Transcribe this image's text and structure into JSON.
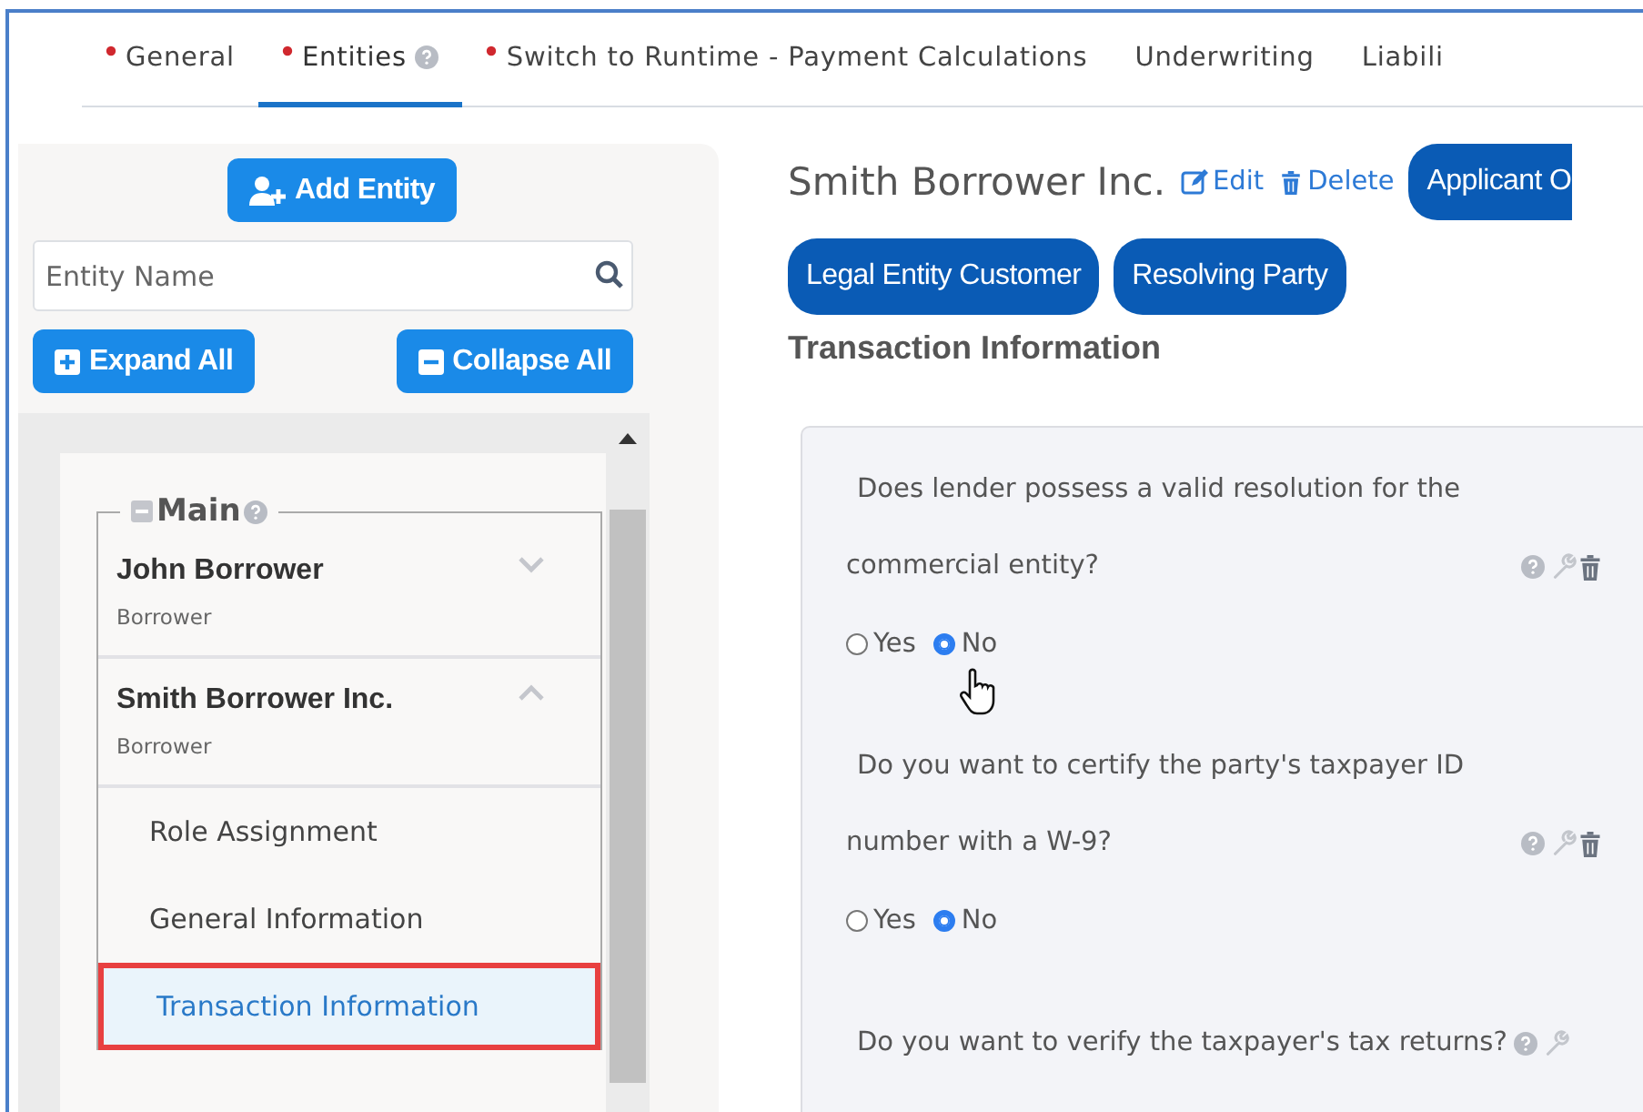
{
  "tabs": [
    {
      "label": "General",
      "required": true,
      "help": false,
      "selected": false
    },
    {
      "label": "Entities",
      "required": true,
      "help": true,
      "selected": true
    },
    {
      "label": "Switch to Runtime - Payment Calculations",
      "required": true,
      "help": false,
      "selected": false
    },
    {
      "label": "Underwriting",
      "required": false,
      "help": false,
      "selected": false
    },
    {
      "label": "Liabili",
      "required": false,
      "help": false,
      "selected": false
    }
  ],
  "sidebar": {
    "add_button": "Add Entity",
    "search": {
      "placeholder": "Entity Name"
    },
    "expand_button": "Expand All",
    "collapse_button": "Collapse All",
    "group": {
      "label": "Main",
      "expanded": true
    },
    "entities": [
      {
        "name": "John Borrower",
        "role": "Borrower",
        "expanded": false
      },
      {
        "name": "Smith Borrower Inc.",
        "role": "Borrower",
        "expanded": true,
        "children": [
          {
            "label": "Role Assignment",
            "selected": false,
            "highlighted": false
          },
          {
            "label": "General Information",
            "selected": false,
            "highlighted": false
          },
          {
            "label": "Transaction Information",
            "selected": true,
            "highlighted": true
          }
        ]
      }
    ]
  },
  "content": {
    "title": "Smith Borrower Inc.",
    "actions": [
      {
        "label": "Edit",
        "kind": "edit"
      },
      {
        "label": "Delete",
        "kind": "delete"
      }
    ],
    "badges": [
      "Applicant O",
      "Legal Entity Customer",
      "Resolving Party"
    ],
    "section_title": "Transaction Information",
    "questions": [
      {
        "text": "Does lender possess a valid resolution for the commercial entity?",
        "deletable": true,
        "options": [
          {
            "label": "Yes",
            "selected": false
          },
          {
            "label": "No",
            "selected": true
          }
        ]
      },
      {
        "text": "Do you want to certify the party's taxpayer ID number with a W-9?",
        "deletable": true,
        "options": [
          {
            "label": "Yes",
            "selected": false
          },
          {
            "label": "No",
            "selected": true
          }
        ]
      },
      {
        "text": "Do you want to verify the taxpayer's tax returns?",
        "deletable": false
      }
    ]
  }
}
